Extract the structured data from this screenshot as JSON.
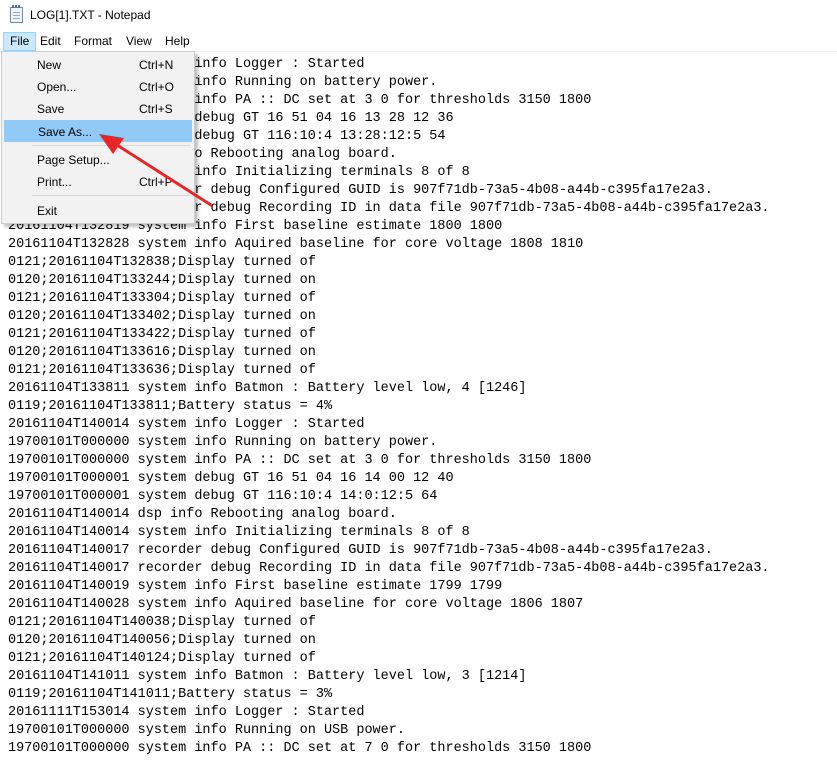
{
  "window": {
    "title": "LOG[1].TXT - Notepad"
  },
  "menubar": {
    "items": [
      "File",
      "Edit",
      "Format",
      "View",
      "Help"
    ]
  },
  "file_menu": {
    "new": {
      "label": "New",
      "shortcut": "Ctrl+N"
    },
    "open": {
      "label": "Open...",
      "shortcut": "Ctrl+O"
    },
    "save": {
      "label": "Save",
      "shortcut": "Ctrl+S"
    },
    "save_as": {
      "label": "Save As..."
    },
    "page_setup": {
      "label": "Page Setup..."
    },
    "print": {
      "label": "Print...",
      "shortcut": "Ctrl+P"
    },
    "exit": {
      "label": "Exit"
    }
  },
  "annotation": {
    "arrow_color": "#e8262a"
  },
  "editor": {
    "lines": [
      "20161104T132809 system info Logger : Started",
      "19700101T000000 system info Running on battery power.",
      "19700101T000000 system info PA :: DC set at 3 0 for thresholds 3150 1800",
      "19700101T000001 system debug GT 16 51 04 16 13 28 12 36",
      "19700101T000001 system debug GT 116:10:4 13:28:12:5 54",
      "20161104T132810 dsp info Rebooting analog board.",
      "20161104T132810 system info Initializing terminals 8 of 8",
      "20161104T132812 recorder debug Configured GUID is 907f71db-73a5-4b08-a44b-c395fa17e2a3.",
      "20161104T132812 recorder debug Recording ID in data file 907f71db-73a5-4b08-a44b-c395fa17e2a3.",
      "20161104T132819 system info First baseline estimate 1800 1800",
      "20161104T132828 system info Aquired baseline for core voltage 1808 1810",
      "0121;20161104T132838;Display turned of",
      "0120;20161104T133244;Display turned on",
      "0121;20161104T133304;Display turned of",
      "0120;20161104T133402;Display turned on",
      "0121;20161104T133422;Display turned of",
      "0120;20161104T133616;Display turned on",
      "0121;20161104T133636;Display turned of",
      "20161104T133811 system info Batmon : Battery level low, 4 [1246]",
      "0119;20161104T133811;Battery status = 4%",
      "20161104T140014 system info Logger : Started",
      "19700101T000000 system info Running on battery power.",
      "19700101T000000 system info PA :: DC set at 3 0 for thresholds 3150 1800",
      "19700101T000001 system debug GT 16 51 04 16 14 00 12 40",
      "19700101T000001 system debug GT 116:10:4 14:0:12:5 64",
      "20161104T140014 dsp info Rebooting analog board.",
      "20161104T140014 system info Initializing terminals 8 of 8",
      "20161104T140017 recorder debug Configured GUID is 907f71db-73a5-4b08-a44b-c395fa17e2a3.",
      "20161104T140017 recorder debug Recording ID in data file 907f71db-73a5-4b08-a44b-c395fa17e2a3.",
      "20161104T140019 system info First baseline estimate 1799 1799",
      "20161104T140028 system info Aquired baseline for core voltage 1806 1807",
      "0121;20161104T140038;Display turned of",
      "0120;20161104T140056;Display turned on",
      "0121;20161104T140124;Display turned of",
      "20161104T141011 system info Batmon : Battery level low, 3 [1214]",
      "0119;20161104T141011;Battery status = 3%",
      "20161111T153014 system info Logger : Started",
      "19700101T000000 system info Running on USB power.",
      "19700101T000000 system info PA :: DC set at 7 0 for thresholds 3150 1800"
    ]
  }
}
